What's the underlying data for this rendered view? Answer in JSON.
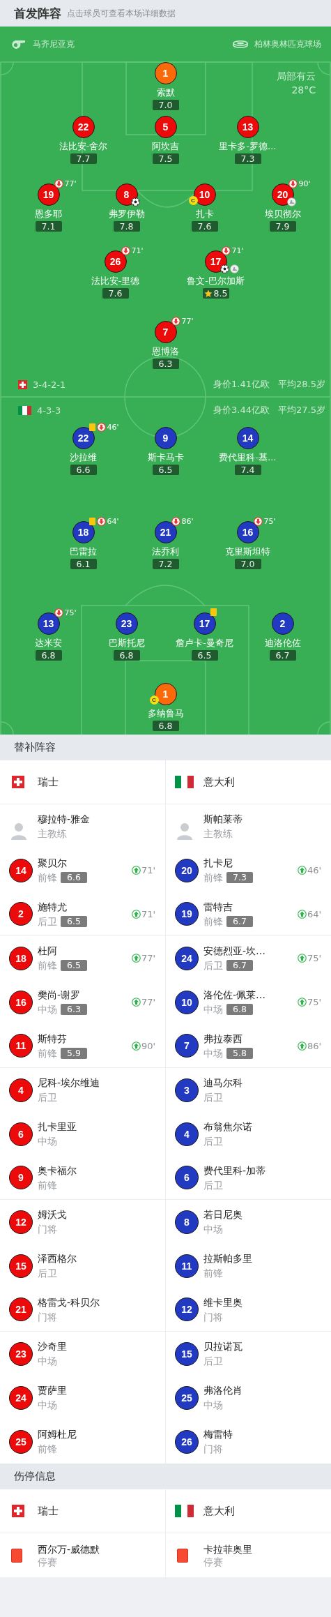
{
  "header": {
    "title": "首发阵容",
    "hint": "点击球员可查看本场详细数据"
  },
  "match_info": {
    "referee": "马齐尼亚克",
    "stadium": "柏林奥林匹克球场",
    "weather": "局部有云",
    "temperature": "28°C"
  },
  "lineups": [
    {
      "kind": "swiss",
      "formation": "3-4-2-1",
      "market_value": "身价1.41亿欧",
      "average_age": "平均28.5岁",
      "lines": [
        [
          {
            "number": "1",
            "name": "索默",
            "rating": "7.0",
            "kind": "goalkeeper",
            "captain": false,
            "goal": false,
            "assist": false,
            "yellow_card": false,
            "top_rated": false
          }
        ],
        [
          {
            "number": "22",
            "name": "法比安-舍尔",
            "rating": "7.7",
            "kind": "outfield",
            "captain": false,
            "goal": false,
            "assist": false,
            "yellow_card": false,
            "top_rated": false
          },
          {
            "number": "5",
            "name": "阿坎吉",
            "rating": "7.5",
            "kind": "outfield",
            "captain": false,
            "goal": false,
            "assist": false,
            "yellow_card": false,
            "top_rated": false
          },
          {
            "number": "13",
            "name": "里卡多-罗德…",
            "rating": "7.3",
            "kind": "outfield",
            "captain": false,
            "goal": false,
            "assist": false,
            "yellow_card": false,
            "top_rated": false
          }
        ],
        [
          {
            "number": "19",
            "name": "恩多耶",
            "rating": "7.1",
            "kind": "outfield",
            "captain": false,
            "goal": false,
            "assist": false,
            "yellow_card": false,
            "top_rated": false,
            "sub_off": "77'"
          },
          {
            "number": "8",
            "name": "弗罗伊勒",
            "rating": "7.8",
            "kind": "outfield",
            "captain": false,
            "goal": true,
            "assist": false,
            "yellow_card": false,
            "top_rated": false
          },
          {
            "number": "10",
            "name": "扎卡",
            "rating": "7.6",
            "kind": "outfield",
            "captain": true,
            "captain_badge": "C",
            "goal": false,
            "assist": false,
            "yellow_card": false,
            "top_rated": false
          },
          {
            "number": "20",
            "name": "埃贝彻尔",
            "rating": "7.9",
            "kind": "outfield",
            "captain": false,
            "goal": false,
            "assist": true,
            "yellow_card": false,
            "top_rated": false,
            "sub_off": "90'"
          }
        ],
        [
          {
            "number": "26",
            "name": "法比安-里德",
            "rating": "7.6",
            "kind": "outfield",
            "captain": false,
            "goal": false,
            "assist": false,
            "yellow_card": false,
            "top_rated": false,
            "sub_off": "71'"
          },
          {
            "number": "17",
            "name": "鲁文-巴尔加斯",
            "rating": "8.5",
            "kind": "outfield",
            "captain": false,
            "goal": true,
            "assist": true,
            "yellow_card": false,
            "top_rated": true,
            "sub_off": "71'"
          }
        ],
        [
          {
            "number": "7",
            "name": "恩博洛",
            "rating": "6.3",
            "kind": "outfield",
            "captain": false,
            "goal": false,
            "assist": false,
            "yellow_card": false,
            "top_rated": false,
            "sub_off": "77'"
          }
        ]
      ]
    },
    {
      "kind": "italian",
      "formation": "4-3-3",
      "market_value": "身价3.44亿欧",
      "average_age": "平均27.5岁",
      "lines": [
        [
          {
            "number": "22",
            "name": "沙拉维",
            "rating": "6.6",
            "kind": "outfield",
            "captain": false,
            "goal": false,
            "assist": false,
            "yellow_card": true,
            "top_rated": false,
            "sub_off": "46'"
          },
          {
            "number": "9",
            "name": "斯卡马卡",
            "rating": "6.5",
            "kind": "outfield",
            "captain": false,
            "goal": false,
            "assist": false,
            "yellow_card": false,
            "top_rated": false
          },
          {
            "number": "14",
            "name": "费代里科-基…",
            "rating": "7.4",
            "kind": "outfield",
            "captain": false,
            "goal": false,
            "assist": false,
            "yellow_card": false,
            "top_rated": false
          }
        ],
        [
          {
            "number": "18",
            "name": "巴雷拉",
            "rating": "6.1",
            "kind": "outfield",
            "captain": false,
            "goal": false,
            "assist": false,
            "yellow_card": true,
            "top_rated": false,
            "sub_off": "64'"
          },
          {
            "number": "21",
            "name": "法乔利",
            "rating": "7.2",
            "kind": "outfield",
            "captain": false,
            "goal": false,
            "assist": false,
            "yellow_card": false,
            "top_rated": false,
            "sub_off": "86'"
          },
          {
            "number": "16",
            "name": "克里斯坦特",
            "rating": "7.0",
            "kind": "outfield",
            "captain": false,
            "goal": false,
            "assist": false,
            "yellow_card": false,
            "top_rated": false,
            "sub_off": "75'"
          }
        ],
        [
          {
            "number": "13",
            "name": "达米安",
            "rating": "6.8",
            "kind": "outfield",
            "captain": false,
            "goal": false,
            "assist": false,
            "yellow_card": false,
            "top_rated": false,
            "sub_off": "75'"
          },
          {
            "number": "23",
            "name": "巴斯托尼",
            "rating": "6.8",
            "kind": "outfield",
            "captain": false,
            "goal": false,
            "assist": false,
            "yellow_card": false,
            "top_rated": false
          },
          {
            "number": "17",
            "name": "詹卢卡-曼奇尼",
            "rating": "6.5",
            "kind": "outfield",
            "captain": false,
            "goal": false,
            "assist": false,
            "yellow_card": true,
            "top_rated": false
          },
          {
            "number": "2",
            "name": "迪洛伦佐",
            "rating": "6.7",
            "kind": "outfield",
            "captain": false,
            "goal": false,
            "assist": false,
            "yellow_card": false,
            "top_rated": false
          }
        ],
        [
          {
            "number": "1",
            "name": "多纳鲁马",
            "rating": "6.8",
            "kind": "goalkeeper",
            "captain": true,
            "captain_badge": "C",
            "goal": false,
            "assist": false,
            "yellow_card": false,
            "top_rated": false
          }
        ]
      ]
    }
  ],
  "substitutes": {
    "title": "替补阵容",
    "teams": [
      {
        "kind": "swiss",
        "name": "瑞士",
        "coach": {
          "name": "穆拉特-雅金",
          "role": "主教练"
        },
        "players": [
          {
            "number": "14",
            "name": "聚贝尔",
            "position": "前锋",
            "rating": "6.6",
            "sub_on": "71'"
          },
          {
            "number": "2",
            "name": "施特尤",
            "position": "后卫",
            "rating": "6.5",
            "sub_on": "71'"
          },
          {
            "number": "18",
            "name": "杜阿",
            "position": "前锋",
            "rating": "6.5",
            "sub_on": "77'"
          },
          {
            "number": "16",
            "name": "樊尚-谢罗",
            "position": "中场",
            "rating": "6.3",
            "sub_on": "77'"
          },
          {
            "number": "11",
            "name": "斯特芬",
            "position": "前锋",
            "rating": "5.9",
            "sub_on": "90'"
          },
          {
            "number": "4",
            "name": "尼科-埃尔维迪",
            "position": "后卫"
          },
          {
            "number": "6",
            "name": "扎卡里亚",
            "position": "中场"
          },
          {
            "number": "9",
            "name": "奥卡福尔",
            "position": "前锋"
          },
          {
            "number": "12",
            "name": "姆沃戈",
            "position": "门将"
          },
          {
            "number": "15",
            "name": "泽西格尔",
            "position": "后卫"
          },
          {
            "number": "21",
            "name": "格雷戈-科贝尔",
            "position": "门将"
          },
          {
            "number": "23",
            "name": "沙奇里",
            "position": "中场"
          },
          {
            "number": "24",
            "name": "贾萨里",
            "position": "中场"
          },
          {
            "number": "25",
            "name": "阿姆杜尼",
            "position": "前锋"
          }
        ]
      },
      {
        "kind": "italian",
        "name": "意大利",
        "coach": {
          "name": "斯帕莱蒂",
          "role": "主教练"
        },
        "players": [
          {
            "number": "20",
            "name": "扎卡尼",
            "position": "前锋",
            "rating": "7.3",
            "sub_on": "46'"
          },
          {
            "number": "19",
            "name": "雷特吉",
            "position": "前锋",
            "rating": "6.7",
            "sub_on": "64'"
          },
          {
            "number": "24",
            "name": "安德烈亚-坎…",
            "position": "后卫",
            "rating": "6.7",
            "sub_on": "75'"
          },
          {
            "number": "10",
            "name": "洛伦佐-佩莱…",
            "position": "中场",
            "rating": "6.8",
            "sub_on": "75'"
          },
          {
            "number": "7",
            "name": "弗拉泰西",
            "position": "中场",
            "rating": "5.8",
            "sub_on": "86'"
          },
          {
            "number": "3",
            "name": "迪马尔科",
            "position": "后卫"
          },
          {
            "number": "4",
            "name": "布翁焦尔诺",
            "position": "后卫"
          },
          {
            "number": "6",
            "name": "费代里科-加蒂",
            "position": "后卫"
          },
          {
            "number": "8",
            "name": "若日尼奥",
            "position": "中场"
          },
          {
            "number": "11",
            "name": "拉斯帕多里",
            "position": "前锋"
          },
          {
            "number": "12",
            "name": "维卡里奥",
            "position": "门将"
          },
          {
            "number": "15",
            "name": "贝拉诺瓦",
            "position": "后卫"
          },
          {
            "number": "25",
            "name": "弗洛伦肖",
            "position": "中场"
          },
          {
            "number": "26",
            "name": "梅雷特",
            "position": "门将"
          }
        ]
      }
    ]
  },
  "injuries": {
    "title": "伤停信息",
    "teams": [
      {
        "kind": "swiss",
        "name": "瑞士",
        "players": [
          {
            "name": "西尔万-威德默",
            "status": "停赛",
            "kind": "red_card"
          }
        ]
      },
      {
        "kind": "italian",
        "name": "意大利",
        "players": [
          {
            "name": "卡拉菲奥里",
            "status": "停赛",
            "kind": "red_card"
          }
        ]
      }
    ]
  }
}
